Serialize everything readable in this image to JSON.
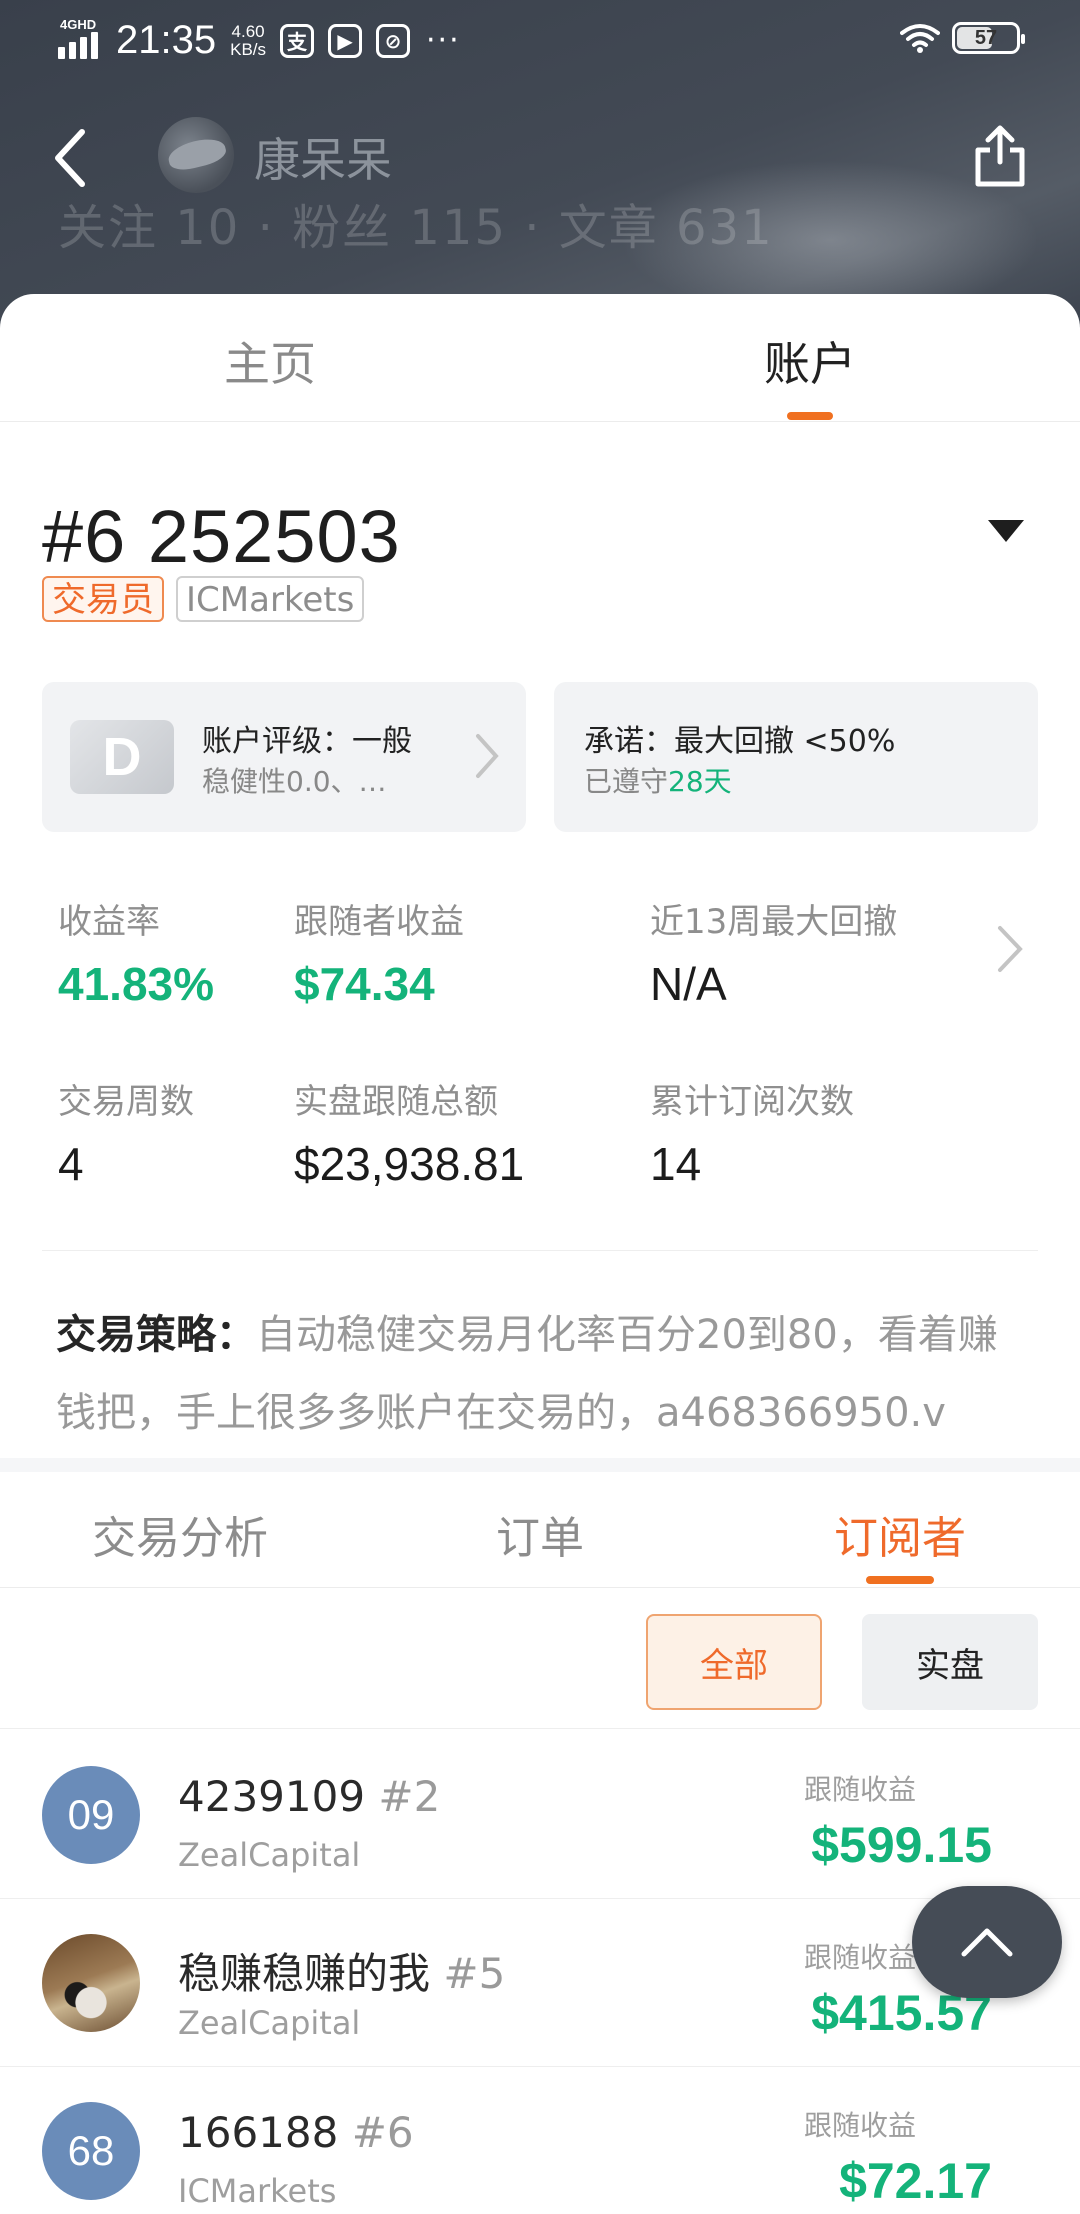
{
  "status_bar": {
    "network": "4GHD",
    "time": "21:35",
    "speed_value": "4.60",
    "speed_unit": "KB/s",
    "battery": "57",
    "overflow": "···"
  },
  "navbar": {
    "user_name": "康呆呆",
    "ghost_stats": "关注 10 · 粉丝 115 · 文章 631"
  },
  "main_tabs": [
    "主页",
    "账户"
  ],
  "account": {
    "title": "#6 252503",
    "tags": [
      "交易员",
      "ICMarkets"
    ]
  },
  "grade_box": {
    "badge": "D",
    "line1": "账户评级：一般",
    "line2": "稳健性0.0、…"
  },
  "promise_box": {
    "line1": "承诺：最大回撤 <50%",
    "line2_prefix": "已遵守",
    "line2_days": "28天"
  },
  "stats": [
    {
      "label": "收益率",
      "value": "41.83%"
    },
    {
      "label": "跟随者收益",
      "value": "$74.34"
    },
    {
      "label": "近13周最大回撤",
      "value": "N/A"
    },
    {
      "label": "交易周数",
      "value": "4"
    },
    {
      "label": "实盘跟随总额",
      "value": "$23,938.81"
    },
    {
      "label": "累计订阅次数",
      "value": "14"
    }
  ],
  "strategy": {
    "key": "交易策略：",
    "text": "自动稳健交易月化率百分20到80，看着赚钱把，手上很多多账户在交易的，a468366950.v"
  },
  "sub_tabs": [
    "交易分析",
    "订单",
    "订阅者"
  ],
  "filters": [
    "全部",
    "实盘"
  ],
  "subscribers": [
    {
      "avatar": "09",
      "name": "4239109",
      "num": "#2",
      "broker": "ZealCapital",
      "profit_label": "跟随收益",
      "profit": "$599.15"
    },
    {
      "avatar": "",
      "name": "稳赚稳赚的我",
      "num": "#5",
      "broker": "ZealCapital",
      "profit_label": "跟随收益",
      "profit": "$415.57"
    },
    {
      "avatar": "68",
      "name": "166188",
      "num": "#6",
      "broker": "ICMarkets",
      "profit_label": "跟随收益",
      "profit": "$72.17"
    }
  ],
  "colors": {
    "accent_orange": "#ef6a2b",
    "profit_green": "#14b37a",
    "header_dark": "#39404b"
  },
  "icons": {
    "back": "chevron-left-icon",
    "share": "share-icon",
    "dropdown": "caret-down-icon",
    "scroll_top": "chevron-up-icon"
  }
}
